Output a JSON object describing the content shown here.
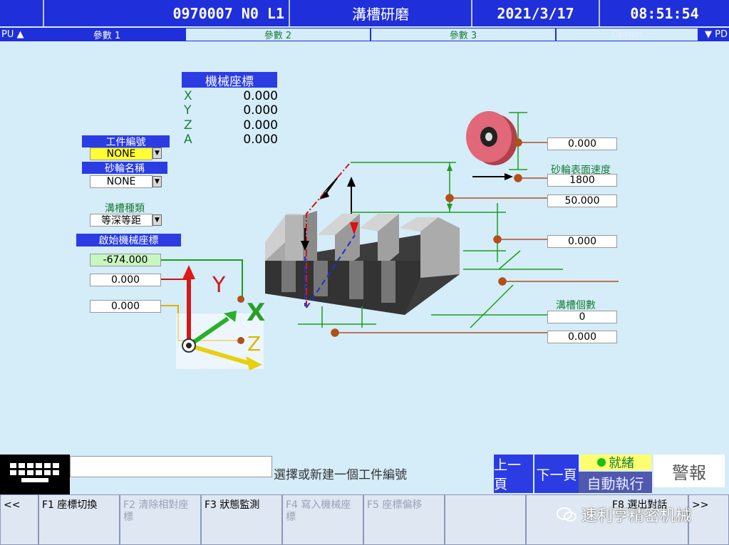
{
  "header": {
    "program": "0970007 N0 L1",
    "title": "溝槽研磨",
    "date": "2021/3/17",
    "time": "08:51:54"
  },
  "tabs": {
    "pu": "PU ▲",
    "items": [
      "參數 1",
      "參數 2",
      "參數 3",
      "Option"
    ],
    "pd": "▼ PD"
  },
  "machine_coords": {
    "title": "機械座標",
    "rows": [
      {
        "axis": "X",
        "value": "0.000"
      },
      {
        "axis": "Y",
        "value": "0.000"
      },
      {
        "axis": "Z",
        "value": "0.000"
      },
      {
        "axis": "A",
        "value": "0.000"
      }
    ]
  },
  "left_panel": {
    "workpiece_label": "工件編號",
    "workpiece_value": "NONE",
    "wheel_label": "砂輪名稱",
    "wheel_value": "NONE",
    "groove_type_label": "溝槽種類",
    "groove_type_value": "等深等距",
    "start_coord_label": "啟始機械座標",
    "start_x": "-674.000",
    "start_y": "0.000",
    "start_z": "0.000"
  },
  "axes": {
    "x": "X",
    "y": "Y",
    "z": "Z"
  },
  "right_fields": {
    "wheel_height": "0.000",
    "wheel_speed_label": "砂輪表面速度",
    "wheel_speed": "1800",
    "lift": "50.000",
    "depth": "0.000",
    "groove_count_label": "溝槽個數",
    "groove_count": "0",
    "pitch": "0.000"
  },
  "bottom": {
    "message": "選擇或新建一個工件編號",
    "prev_page": "上一頁",
    "next_page": "下一頁",
    "ready": "就緒",
    "auto_run": "自動執行",
    "alarm": "警報",
    "fkeys": [
      {
        "label": "<<",
        "enabled": true
      },
      {
        "label": "F1 座標切換",
        "enabled": true
      },
      {
        "label": "F2 清除相對座標",
        "enabled": false
      },
      {
        "label": "F3 狀態監測",
        "enabled": true
      },
      {
        "label": "F4 寫入機械座標",
        "enabled": false
      },
      {
        "label": "F5 座標偏移",
        "enabled": false
      },
      {
        "label": "",
        "enabled": false
      },
      {
        "label": "F8 選出對話",
        "enabled": true
      },
      {
        "label": ">>",
        "enabled": true
      }
    ],
    "watermark": "速利亨精密机械"
  },
  "colors": {
    "bar_blue": "#1f2fd9",
    "label_blue": "#2b3ce3",
    "bg": "#d5ecf9",
    "green_text": "#1a7f3a",
    "highlight_yellow": "#ffff33",
    "highlight_green": "#c8f5c0",
    "leader_brown": "#b0501a"
  }
}
